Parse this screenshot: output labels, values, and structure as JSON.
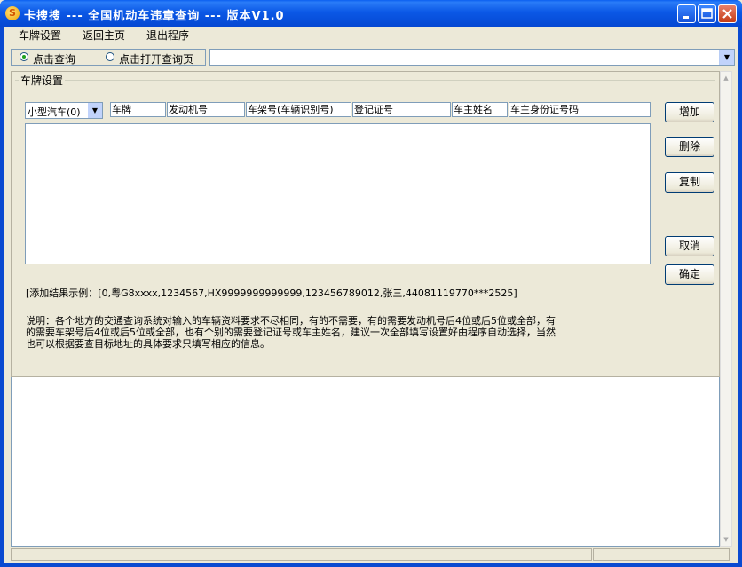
{
  "window": {
    "title": "卡搜搜 --- 全国机动车违章查询 --- 版本V1.0",
    "icon": "app-logo-icon"
  },
  "menu": {
    "items": [
      "车牌设置",
      "返回主页",
      "退出程序"
    ]
  },
  "toolbar": {
    "radio_query": "点击查询",
    "radio_open": "点击打开查询页",
    "url_value": ""
  },
  "plate_settings": {
    "group_title": "车牌设置",
    "vehicle_type": "小型汽车(0)",
    "columns": [
      "车牌",
      "发动机号",
      "车架号(车辆识别号)",
      "登记证号",
      "车主姓名",
      "车主身份证号码"
    ],
    "buttons": {
      "add": "增加",
      "delete": "删除",
      "copy": "复制",
      "cancel": "取消",
      "ok": "确定"
    },
    "example": "[添加结果示例：[0,粤G8xxxx,1234567,HX9999999999999,123456789012,张三,44081119770***2525]",
    "description_lines": [
      "说明：各个地方的交通查询系统对输入的车辆资料要求不尽相同，有的不需要，有的需要发动机号后4位或后5位或全部，有",
      "的需要车架号后4位或后5位或全部，也有个别的需要登记证号或车主姓名，建议一次全部填写设置好由程序自动选择，当然",
      "也可以根据要查目标地址的具体要求只填写相应的信息。"
    ]
  },
  "colors": {
    "titlebar": "#0548d2",
    "window_bg": "#ece9d8",
    "radio_dot": "#21a121"
  }
}
